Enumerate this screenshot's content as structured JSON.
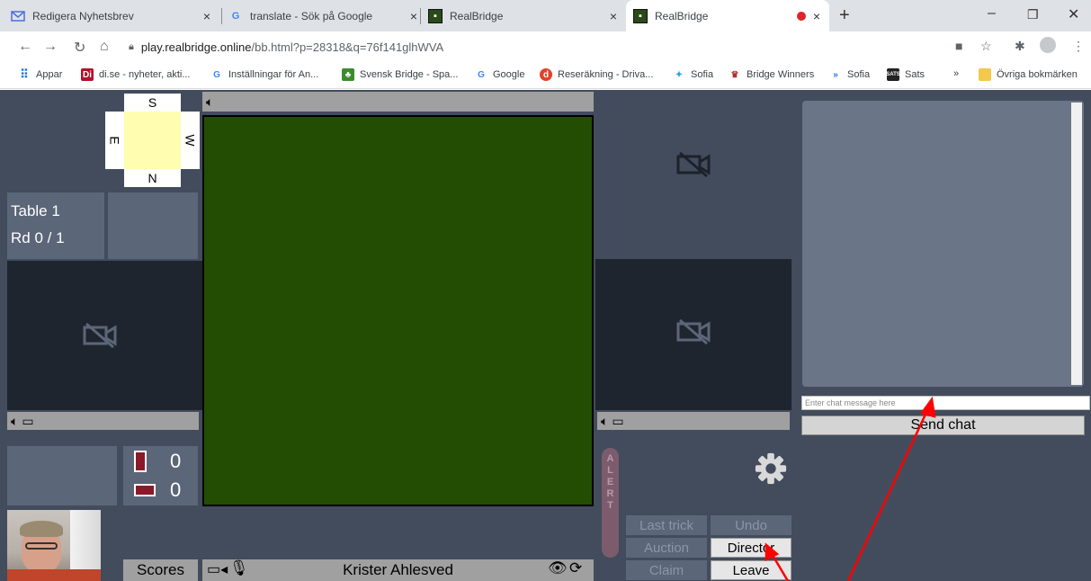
{
  "browser": {
    "tabs": [
      {
        "title": "Redigera Nyhetsbrev",
        "close": "×"
      },
      {
        "title": "translate - Sök på Google",
        "close": "×"
      },
      {
        "title": "RealBridge",
        "close": "×"
      },
      {
        "title": "RealBridge",
        "close": "×",
        "active": true
      }
    ],
    "new_tab": "+",
    "window": {
      "minimize": "–",
      "restore": "❐",
      "close": "✕"
    },
    "address": {
      "host": "play.realbridge.online",
      "path": "/bb.html?p=28318&q=76f141glhWVA"
    },
    "bookmarks": [
      {
        "label": "Appar",
        "icon": "apps-grid-icon"
      },
      {
        "label": "di.se - nyheter, akti...",
        "icon": "di-logo"
      },
      {
        "label": "Inställningar för An...",
        "icon": "google-g"
      },
      {
        "label": "Svensk Bridge - Spa...",
        "icon": "bridge-logo"
      },
      {
        "label": "Google",
        "icon": "google-g"
      },
      {
        "label": "Reseräkning - Driva...",
        "icon": "red-circle-logo"
      },
      {
        "label": "Sofia",
        "icon": "sofia-logo"
      },
      {
        "label": "Bridge Winners",
        "icon": "bridge-winners-logo"
      },
      {
        "label": "Sofia",
        "icon": "chevrons-logo"
      },
      {
        "label": "Sats",
        "icon": "sats-logo"
      }
    ],
    "bookmarks_more": "»",
    "other_bookmarks": "Övriga bokmärken"
  },
  "app": {
    "compass": {
      "south": "S",
      "north": "N",
      "east": "E",
      "west": "W"
    },
    "table": {
      "name": "Table 1",
      "round": "Rd 0 / 1"
    },
    "tricks": {
      "ours": "0",
      "theirs": "0"
    },
    "alert_letters": [
      "A",
      "L",
      "E",
      "R",
      "T"
    ],
    "buttons": {
      "last_trick": "Last trick",
      "undo": "Undo",
      "auction": "Auction",
      "director": "Director",
      "claim": "Claim",
      "leave": "Leave",
      "scores": "Scores"
    },
    "player_name": "Krister Ahlesved",
    "chat": {
      "placeholder": "Enter chat message here",
      "send": "Send chat"
    },
    "colors": {
      "background": "#424c5c",
      "board": "#234d03",
      "annotation_arrow": "#ff0000"
    }
  }
}
